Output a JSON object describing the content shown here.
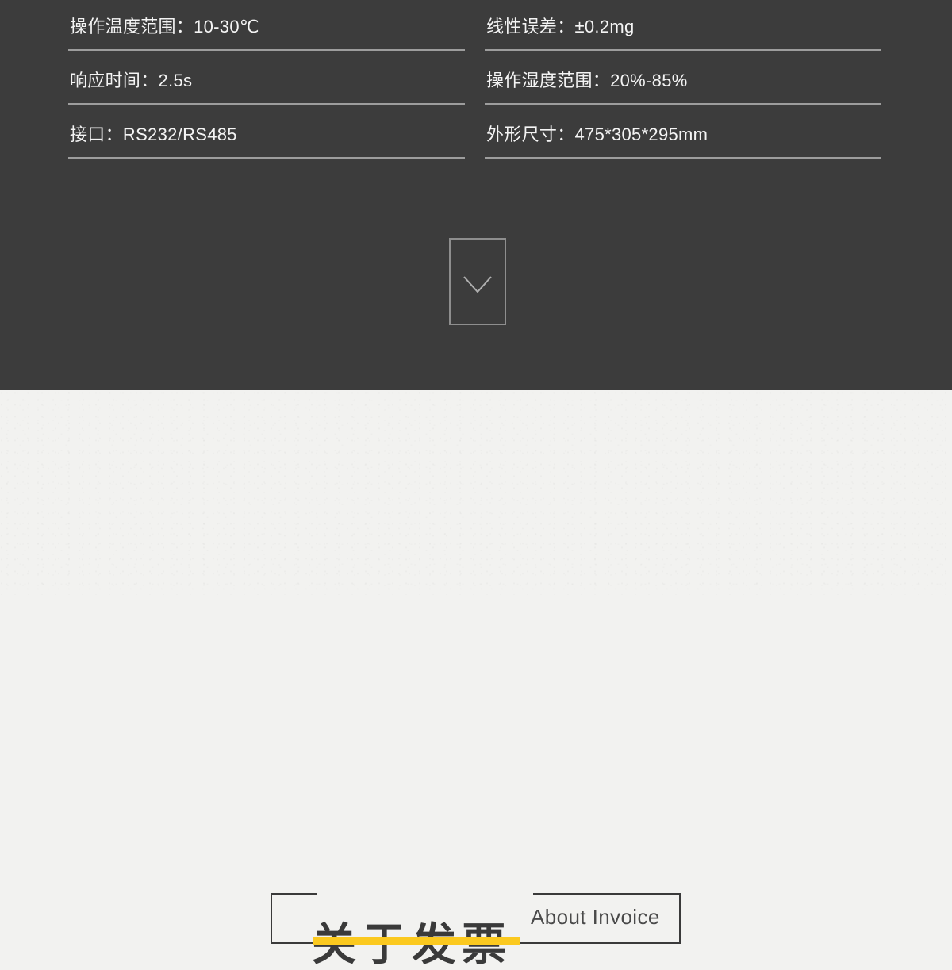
{
  "colors": {
    "dark_background": "#3c3c3c",
    "light_background": "#f2f2f0",
    "divider": "#9d9d9d",
    "spec_text": "#f4f4f4",
    "frame": "#3a3a3a",
    "accent_yellow": "#fbc91f",
    "title_text": "#3a3a3a"
  },
  "spec_section": {
    "left_column": [
      {
        "label": "操作温度范围：",
        "value": "10-30℃",
        "text": "操作温度范围：10-30℃"
      },
      {
        "label": "响应时间：",
        "value": "2.5s",
        "text": "响应时间：2.5s"
      },
      {
        "label": "接口：",
        "value": "RS232/RS485",
        "text": "接口：RS232/RS485"
      }
    ],
    "right_column": [
      {
        "label": "线性误差：",
        "value": "±0.2mg",
        "text": "线性误差：±0.2mg"
      },
      {
        "label": "操作湿度范围：",
        "value": "20%-85%",
        "text": "操作湿度范围：20%-85%"
      },
      {
        "label": "外形尺寸：",
        "value": "475*305*295mm",
        "text": "外形尺寸：475*305*295mm"
      }
    ]
  },
  "scroll_indicator": {
    "icon": "chevron-down-icon"
  },
  "invoice_section": {
    "title_cn": "关于发票",
    "title_en": "About Invoice"
  }
}
